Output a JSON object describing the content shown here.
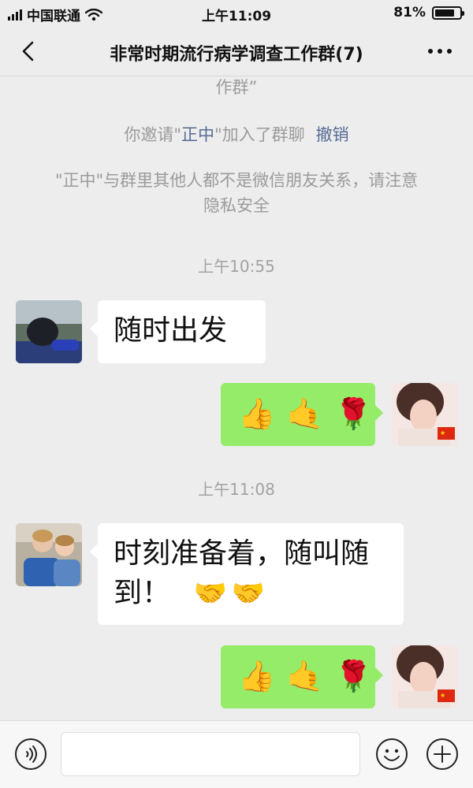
{
  "status_bar": {
    "carrier": "中国联通",
    "time": "上午11:09",
    "battery": "81%",
    "battery_level": 0.81
  },
  "nav": {
    "title": "非常时期流行病学调查工作群(7)"
  },
  "chat": {
    "cut_text": "作群”",
    "invite_notice": {
      "prefix": "你邀请\"",
      "name": "正中",
      "suffix": "\"加入了群聊",
      "revoke": "撤销"
    },
    "privacy_notice": "\"正中\"与群里其他人都不是微信朋友关系，请注意隐私安全",
    "timestamps": [
      "上午10:55",
      "上午11:08"
    ],
    "messages": [
      {
        "side": "in",
        "text": "随时出发"
      },
      {
        "side": "out",
        "emoji": [
          "👍",
          "🤙",
          "🌹"
        ]
      },
      {
        "side": "in",
        "text": "时刻准备着，随叫随到！",
        "emoji": [
          "🤝",
          "🤝"
        ]
      },
      {
        "side": "out",
        "emoji": [
          "👍",
          "🤙",
          "🌹"
        ]
      }
    ]
  },
  "input_bar": {
    "placeholder": ""
  },
  "colors": {
    "background": "#ededed",
    "outgoing_bubble": "#95ec69",
    "incoming_bubble": "#ffffff",
    "link": "#576b95"
  }
}
